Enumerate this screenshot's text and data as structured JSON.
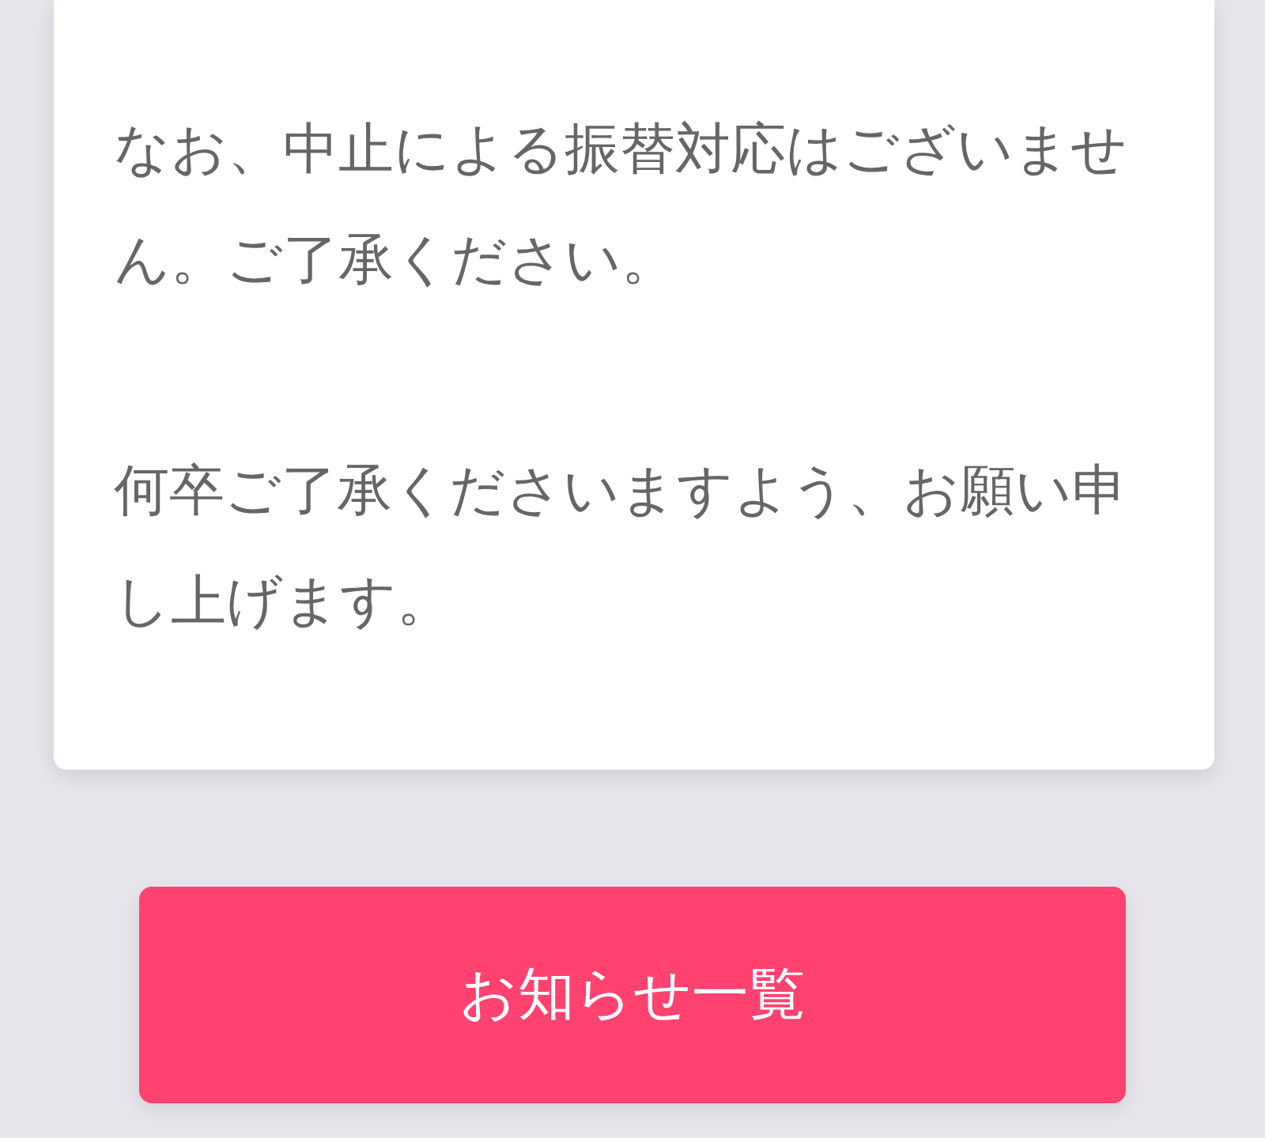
{
  "card": {
    "paragraphs": [
      "なお、中止による振替対応はございません。ご了承ください。",
      "何卒ご了承くださいますよう、お願い申し上げます。"
    ]
  },
  "button": {
    "label": "お知らせ一覧"
  }
}
